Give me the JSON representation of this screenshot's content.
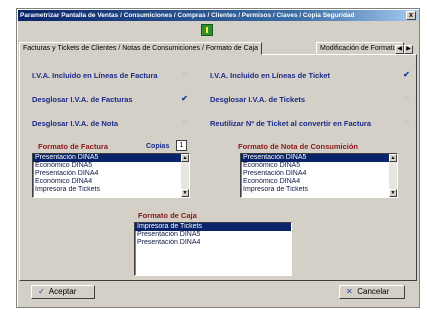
{
  "window": {
    "title": "Parametrizar Pantalla de Ventas / Consumiciones / Compras / Clientes / Permisos / Claves / Copia Seguridad",
    "close_glyph": "x"
  },
  "tabs": [
    {
      "label": "Facturas y Tickets de Clientes / Notas de Consumiciones / Formato de Caja"
    },
    {
      "label": "Modificación de Formatos"
    }
  ],
  "tab_nav": {
    "prev_glyph": "◀",
    "next_glyph": "▶"
  },
  "options": [
    {
      "label": "I.V.A. Incluido en Líneas de Factura",
      "checked": false
    },
    {
      "label": "I.V.A. Incluido en Líneas de Ticket",
      "checked": true
    },
    {
      "label": "Desglosar I.V.A. de Facturas",
      "checked": true
    },
    {
      "label": "Desglosar I.V.A. de Tickets",
      "checked": false
    },
    {
      "label": "Desglosar I.V.A. de Nota",
      "checked": false
    },
    {
      "label": "Reutilizar Nº de Ticket al convertir en Factura",
      "checked": false
    }
  ],
  "check_glyphs": {
    "on": "✔",
    "off": "□"
  },
  "formato_factura": {
    "title": "Formato de Factura",
    "copies_label": "Copias",
    "copies_value": "1",
    "items": [
      "Presentación DINA5",
      "Económico DINA5",
      "Presentación DINA4",
      "Económico DINA4",
      "Impresora de Tickets"
    ],
    "selected": 0
  },
  "formato_nota": {
    "title": "Formato de Nota de Consumición",
    "items": [
      "Presentación DINA5",
      "Económico DINA5",
      "Presentación DINA4",
      "Económico DINA4",
      "Impresora de Tickets"
    ],
    "selected": 0
  },
  "formato_caja": {
    "title": "Formato de Caja",
    "items": [
      "Impresora de Tickets",
      "Presentación DINA5",
      "Presentación DINA4"
    ],
    "selected": 0
  },
  "scroll_glyphs": {
    "up": "▲",
    "down": "▼"
  },
  "buttons": {
    "accept": {
      "label": "Aceptar",
      "icon": "✓"
    },
    "cancel": {
      "label": "Cancelar",
      "icon": "✕"
    }
  }
}
